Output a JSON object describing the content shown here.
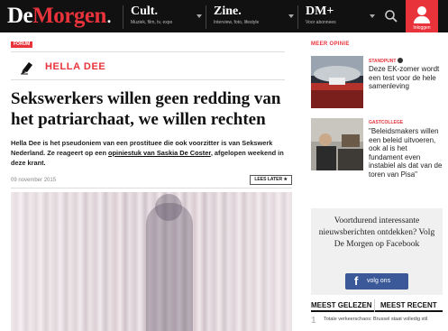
{
  "header": {
    "logo_part1": "De",
    "logo_part2": "Morgen",
    "logo_dot": ".",
    "nav": [
      {
        "title": "Cult.",
        "subtitle": "Muziek, film, tv, expo"
      },
      {
        "title": "Zine.",
        "subtitle": "Interview, foto, lifestyle"
      },
      {
        "title": "DM+",
        "subtitle": "Voor abonnees"
      }
    ],
    "search_icon": "search-icon",
    "user_label": "Inloggen",
    "accent_color": "#e8333b",
    "bar_color": "#111111"
  },
  "article": {
    "category": "FORUM",
    "author": "HELLA DEE",
    "author_icon": "pen-icon",
    "headline": "Sekswerkers willen geen redding van het patriarchaat, we willen rechten",
    "intro_prefix": "Hella Dee is het pseudoniem van een prostituee die ook voorzitter is van Sekswerk Nederland. Ze reageert op een ",
    "intro_link": "opiniestuk van Saskia De Coster",
    "intro_suffix": ", afgelopen weekend in deze krant.",
    "date": "09 november 2015",
    "read_later": "LEES LATER ★"
  },
  "sidebar": {
    "section_title": "MEER OPINIE",
    "opinions": [
      {
        "tag": "STANDPUNT",
        "title": "Deze EK-zomer wordt een test voor de hele samenleving"
      },
      {
        "tag": "GASTCOLLEGE",
        "title": "\"Beleidsmakers willen een beleid uitvoeren, ook al is het fundament even instabiel als dat van de toren van Pisa\""
      }
    ],
    "facebook": {
      "text": "Voortdurend interessante nieuwsberichten ontdekken? Volg De Morgen op Facebook",
      "button": "volg ons",
      "button_color": "#3b5998"
    },
    "tabs": [
      "MEEST GELEZEN",
      "MEEST RECENT"
    ],
    "most_read": [
      {
        "num": "1",
        "text": "Totale verkeerschaos: Brussel staat volledig stil"
      }
    ]
  }
}
